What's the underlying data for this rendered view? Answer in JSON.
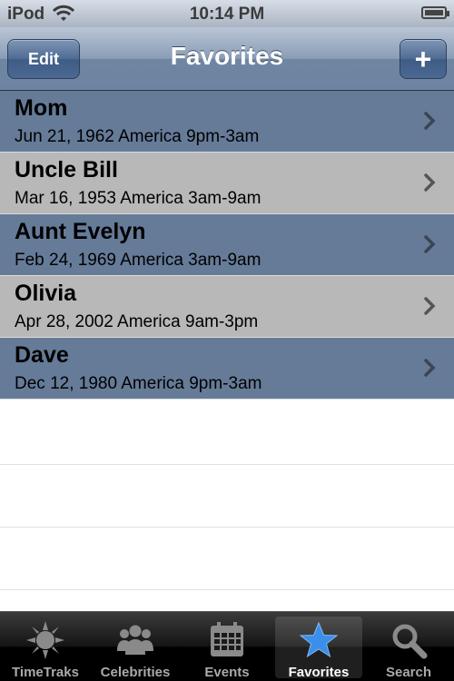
{
  "status_bar": {
    "carrier": "iPod",
    "time": "10:14 PM"
  },
  "navbar": {
    "title": "Favorites",
    "edit_label": "Edit",
    "add_label": "+"
  },
  "favorites": [
    {
      "name": "Mom",
      "detail": "Jun 21, 1962 America 9pm-3am"
    },
    {
      "name": "Uncle Bill",
      "detail": "Mar 16, 1953 America 3am-9am"
    },
    {
      "name": "Aunt Evelyn",
      "detail": "Feb 24, 1969 America 3am-9am"
    },
    {
      "name": "Olivia",
      "detail": "Apr 28, 2002 America 9am-3pm"
    },
    {
      "name": "Dave",
      "detail": "Dec 12, 1980 America 9pm-3am"
    }
  ],
  "tabs": [
    {
      "label": "TimeTraks",
      "icon": "sun-icon"
    },
    {
      "label": "Celebrities",
      "icon": "people-icon"
    },
    {
      "label": "Events",
      "icon": "calendar-icon"
    },
    {
      "label": "Favorites",
      "icon": "star-icon"
    },
    {
      "label": "Search",
      "icon": "magnifier-icon"
    }
  ],
  "colors": {
    "row_blue": "#657b98",
    "row_gray": "#b8b8b8",
    "active_star": "#3b8fe8"
  }
}
